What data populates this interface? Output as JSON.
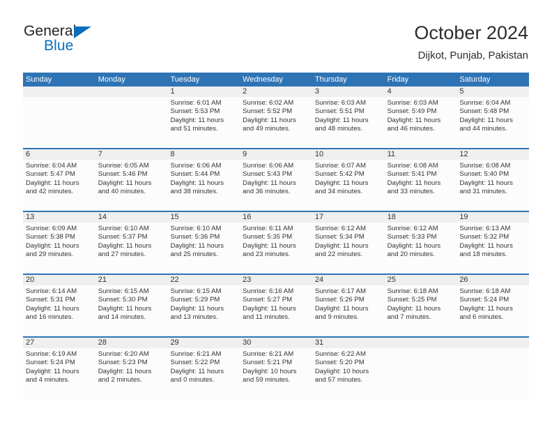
{
  "logo": {
    "word_top": "General",
    "word_bottom": "Blue",
    "triangle_icon": "triangle-icon",
    "color_black": "#231f20",
    "color_blue": "#0a6ebd"
  },
  "header": {
    "title": "October 2024",
    "subtitle": "Dijkot, Punjab, Pakistan"
  },
  "theme": {
    "header_blue": "#2e74b5",
    "daynum_band": "#efefef",
    "cell_background": "#fcfcfc",
    "text": "#333333"
  },
  "weekdays": [
    "Sunday",
    "Monday",
    "Tuesday",
    "Wednesday",
    "Thursday",
    "Friday",
    "Saturday"
  ],
  "weeks": [
    [
      {
        "day": "",
        "sunrise": "",
        "sunset": "",
        "daylight_1": "",
        "daylight_2": ""
      },
      {
        "day": "",
        "sunrise": "",
        "sunset": "",
        "daylight_1": "",
        "daylight_2": ""
      },
      {
        "day": "1",
        "sunrise": "Sunrise: 6:01 AM",
        "sunset": "Sunset: 5:53 PM",
        "daylight_1": "Daylight: 11 hours",
        "daylight_2": "and 51 minutes."
      },
      {
        "day": "2",
        "sunrise": "Sunrise: 6:02 AM",
        "sunset": "Sunset: 5:52 PM",
        "daylight_1": "Daylight: 11 hours",
        "daylight_2": "and 49 minutes."
      },
      {
        "day": "3",
        "sunrise": "Sunrise: 6:03 AM",
        "sunset": "Sunset: 5:51 PM",
        "daylight_1": "Daylight: 11 hours",
        "daylight_2": "and 48 minutes."
      },
      {
        "day": "4",
        "sunrise": "Sunrise: 6:03 AM",
        "sunset": "Sunset: 5:49 PM",
        "daylight_1": "Daylight: 11 hours",
        "daylight_2": "and 46 minutes."
      },
      {
        "day": "5",
        "sunrise": "Sunrise: 6:04 AM",
        "sunset": "Sunset: 5:48 PM",
        "daylight_1": "Daylight: 11 hours",
        "daylight_2": "and 44 minutes."
      }
    ],
    [
      {
        "day": "6",
        "sunrise": "Sunrise: 6:04 AM",
        "sunset": "Sunset: 5:47 PM",
        "daylight_1": "Daylight: 11 hours",
        "daylight_2": "and 42 minutes."
      },
      {
        "day": "7",
        "sunrise": "Sunrise: 6:05 AM",
        "sunset": "Sunset: 5:46 PM",
        "daylight_1": "Daylight: 11 hours",
        "daylight_2": "and 40 minutes."
      },
      {
        "day": "8",
        "sunrise": "Sunrise: 6:06 AM",
        "sunset": "Sunset: 5:44 PM",
        "daylight_1": "Daylight: 11 hours",
        "daylight_2": "and 38 minutes."
      },
      {
        "day": "9",
        "sunrise": "Sunrise: 6:06 AM",
        "sunset": "Sunset: 5:43 PM",
        "daylight_1": "Daylight: 11 hours",
        "daylight_2": "and 36 minutes."
      },
      {
        "day": "10",
        "sunrise": "Sunrise: 6:07 AM",
        "sunset": "Sunset: 5:42 PM",
        "daylight_1": "Daylight: 11 hours",
        "daylight_2": "and 34 minutes."
      },
      {
        "day": "11",
        "sunrise": "Sunrise: 6:08 AM",
        "sunset": "Sunset: 5:41 PM",
        "daylight_1": "Daylight: 11 hours",
        "daylight_2": "and 33 minutes."
      },
      {
        "day": "12",
        "sunrise": "Sunrise: 6:08 AM",
        "sunset": "Sunset: 5:40 PM",
        "daylight_1": "Daylight: 11 hours",
        "daylight_2": "and 31 minutes."
      }
    ],
    [
      {
        "day": "13",
        "sunrise": "Sunrise: 6:09 AM",
        "sunset": "Sunset: 5:38 PM",
        "daylight_1": "Daylight: 11 hours",
        "daylight_2": "and 29 minutes."
      },
      {
        "day": "14",
        "sunrise": "Sunrise: 6:10 AM",
        "sunset": "Sunset: 5:37 PM",
        "daylight_1": "Daylight: 11 hours",
        "daylight_2": "and 27 minutes."
      },
      {
        "day": "15",
        "sunrise": "Sunrise: 6:10 AM",
        "sunset": "Sunset: 5:36 PM",
        "daylight_1": "Daylight: 11 hours",
        "daylight_2": "and 25 minutes."
      },
      {
        "day": "16",
        "sunrise": "Sunrise: 6:11 AM",
        "sunset": "Sunset: 5:35 PM",
        "daylight_1": "Daylight: 11 hours",
        "daylight_2": "and 23 minutes."
      },
      {
        "day": "17",
        "sunrise": "Sunrise: 6:12 AM",
        "sunset": "Sunset: 5:34 PM",
        "daylight_1": "Daylight: 11 hours",
        "daylight_2": "and 22 minutes."
      },
      {
        "day": "18",
        "sunrise": "Sunrise: 6:12 AM",
        "sunset": "Sunset: 5:33 PM",
        "daylight_1": "Daylight: 11 hours",
        "daylight_2": "and 20 minutes."
      },
      {
        "day": "19",
        "sunrise": "Sunrise: 6:13 AM",
        "sunset": "Sunset: 5:32 PM",
        "daylight_1": "Daylight: 11 hours",
        "daylight_2": "and 18 minutes."
      }
    ],
    [
      {
        "day": "20",
        "sunrise": "Sunrise: 6:14 AM",
        "sunset": "Sunset: 5:31 PM",
        "daylight_1": "Daylight: 11 hours",
        "daylight_2": "and 16 minutes."
      },
      {
        "day": "21",
        "sunrise": "Sunrise: 6:15 AM",
        "sunset": "Sunset: 5:30 PM",
        "daylight_1": "Daylight: 11 hours",
        "daylight_2": "and 14 minutes."
      },
      {
        "day": "22",
        "sunrise": "Sunrise: 6:15 AM",
        "sunset": "Sunset: 5:29 PM",
        "daylight_1": "Daylight: 11 hours",
        "daylight_2": "and 13 minutes."
      },
      {
        "day": "23",
        "sunrise": "Sunrise: 6:16 AM",
        "sunset": "Sunset: 5:27 PM",
        "daylight_1": "Daylight: 11 hours",
        "daylight_2": "and 11 minutes."
      },
      {
        "day": "24",
        "sunrise": "Sunrise: 6:17 AM",
        "sunset": "Sunset: 5:26 PM",
        "daylight_1": "Daylight: 11 hours",
        "daylight_2": "and 9 minutes."
      },
      {
        "day": "25",
        "sunrise": "Sunrise: 6:18 AM",
        "sunset": "Sunset: 5:25 PM",
        "daylight_1": "Daylight: 11 hours",
        "daylight_2": "and 7 minutes."
      },
      {
        "day": "26",
        "sunrise": "Sunrise: 6:18 AM",
        "sunset": "Sunset: 5:24 PM",
        "daylight_1": "Daylight: 11 hours",
        "daylight_2": "and 6 minutes."
      }
    ],
    [
      {
        "day": "27",
        "sunrise": "Sunrise: 6:19 AM",
        "sunset": "Sunset: 5:24 PM",
        "daylight_1": "Daylight: 11 hours",
        "daylight_2": "and 4 minutes."
      },
      {
        "day": "28",
        "sunrise": "Sunrise: 6:20 AM",
        "sunset": "Sunset: 5:23 PM",
        "daylight_1": "Daylight: 11 hours",
        "daylight_2": "and 2 minutes."
      },
      {
        "day": "29",
        "sunrise": "Sunrise: 6:21 AM",
        "sunset": "Sunset: 5:22 PM",
        "daylight_1": "Daylight: 11 hours",
        "daylight_2": "and 0 minutes."
      },
      {
        "day": "30",
        "sunrise": "Sunrise: 6:21 AM",
        "sunset": "Sunset: 5:21 PM",
        "daylight_1": "Daylight: 10 hours",
        "daylight_2": "and 59 minutes."
      },
      {
        "day": "31",
        "sunrise": "Sunrise: 6:22 AM",
        "sunset": "Sunset: 5:20 PM",
        "daylight_1": "Daylight: 10 hours",
        "daylight_2": "and 57 minutes."
      },
      {
        "day": "",
        "sunrise": "",
        "sunset": "",
        "daylight_1": "",
        "daylight_2": ""
      },
      {
        "day": "",
        "sunrise": "",
        "sunset": "",
        "daylight_1": "",
        "daylight_2": ""
      }
    ]
  ]
}
